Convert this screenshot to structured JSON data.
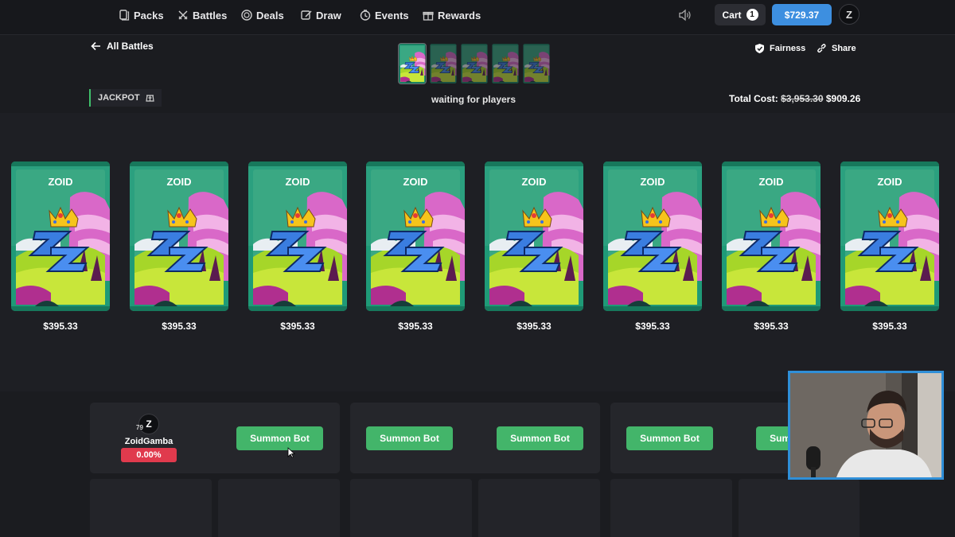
{
  "nav": {
    "items": [
      {
        "label": "Packs",
        "icon": "packs-icon"
      },
      {
        "label": "Battles",
        "icon": "swords-icon"
      },
      {
        "label": "Deals",
        "icon": "deals-icon"
      },
      {
        "label": "Draw",
        "icon": "draw-icon"
      },
      {
        "label": "Events",
        "icon": "events-icon"
      },
      {
        "label": "Rewards",
        "icon": "gift-icon"
      }
    ],
    "cart_label": "Cart",
    "cart_count": "1",
    "balance": "$729.37",
    "avatar_letter": "Z"
  },
  "battle": {
    "back_label": "All Battles",
    "fairness_label": "Fairness",
    "share_label": "Share",
    "mode_label": "JACKPOT",
    "status": "waiting for players",
    "total_label": "Total Cost:",
    "total_old": "$3,953.30",
    "total_new": "$909.26"
  },
  "packs": [
    {
      "title": "ZOID",
      "price": "$395.33"
    },
    {
      "title": "ZOID",
      "price": "$395.33"
    },
    {
      "title": "ZOID",
      "price": "$395.33"
    },
    {
      "title": "ZOID",
      "price": "$395.33"
    },
    {
      "title": "ZOID",
      "price": "$395.33"
    },
    {
      "title": "ZOID",
      "price": "$395.33"
    },
    {
      "title": "ZOID",
      "price": "$395.33"
    },
    {
      "title": "ZOID",
      "price": "$395.33"
    }
  ],
  "player": {
    "name": "ZoidGamba",
    "level": "79",
    "percent": "0.00%",
    "avatar_letter": "Z"
  },
  "summon_label": "Summon Bot",
  "colors": {
    "accent_blue": "#3d8fe0",
    "bot_green": "#43b56a",
    "percent_red": "#e03a4d",
    "jackpot_green": "#3fbf6a"
  }
}
